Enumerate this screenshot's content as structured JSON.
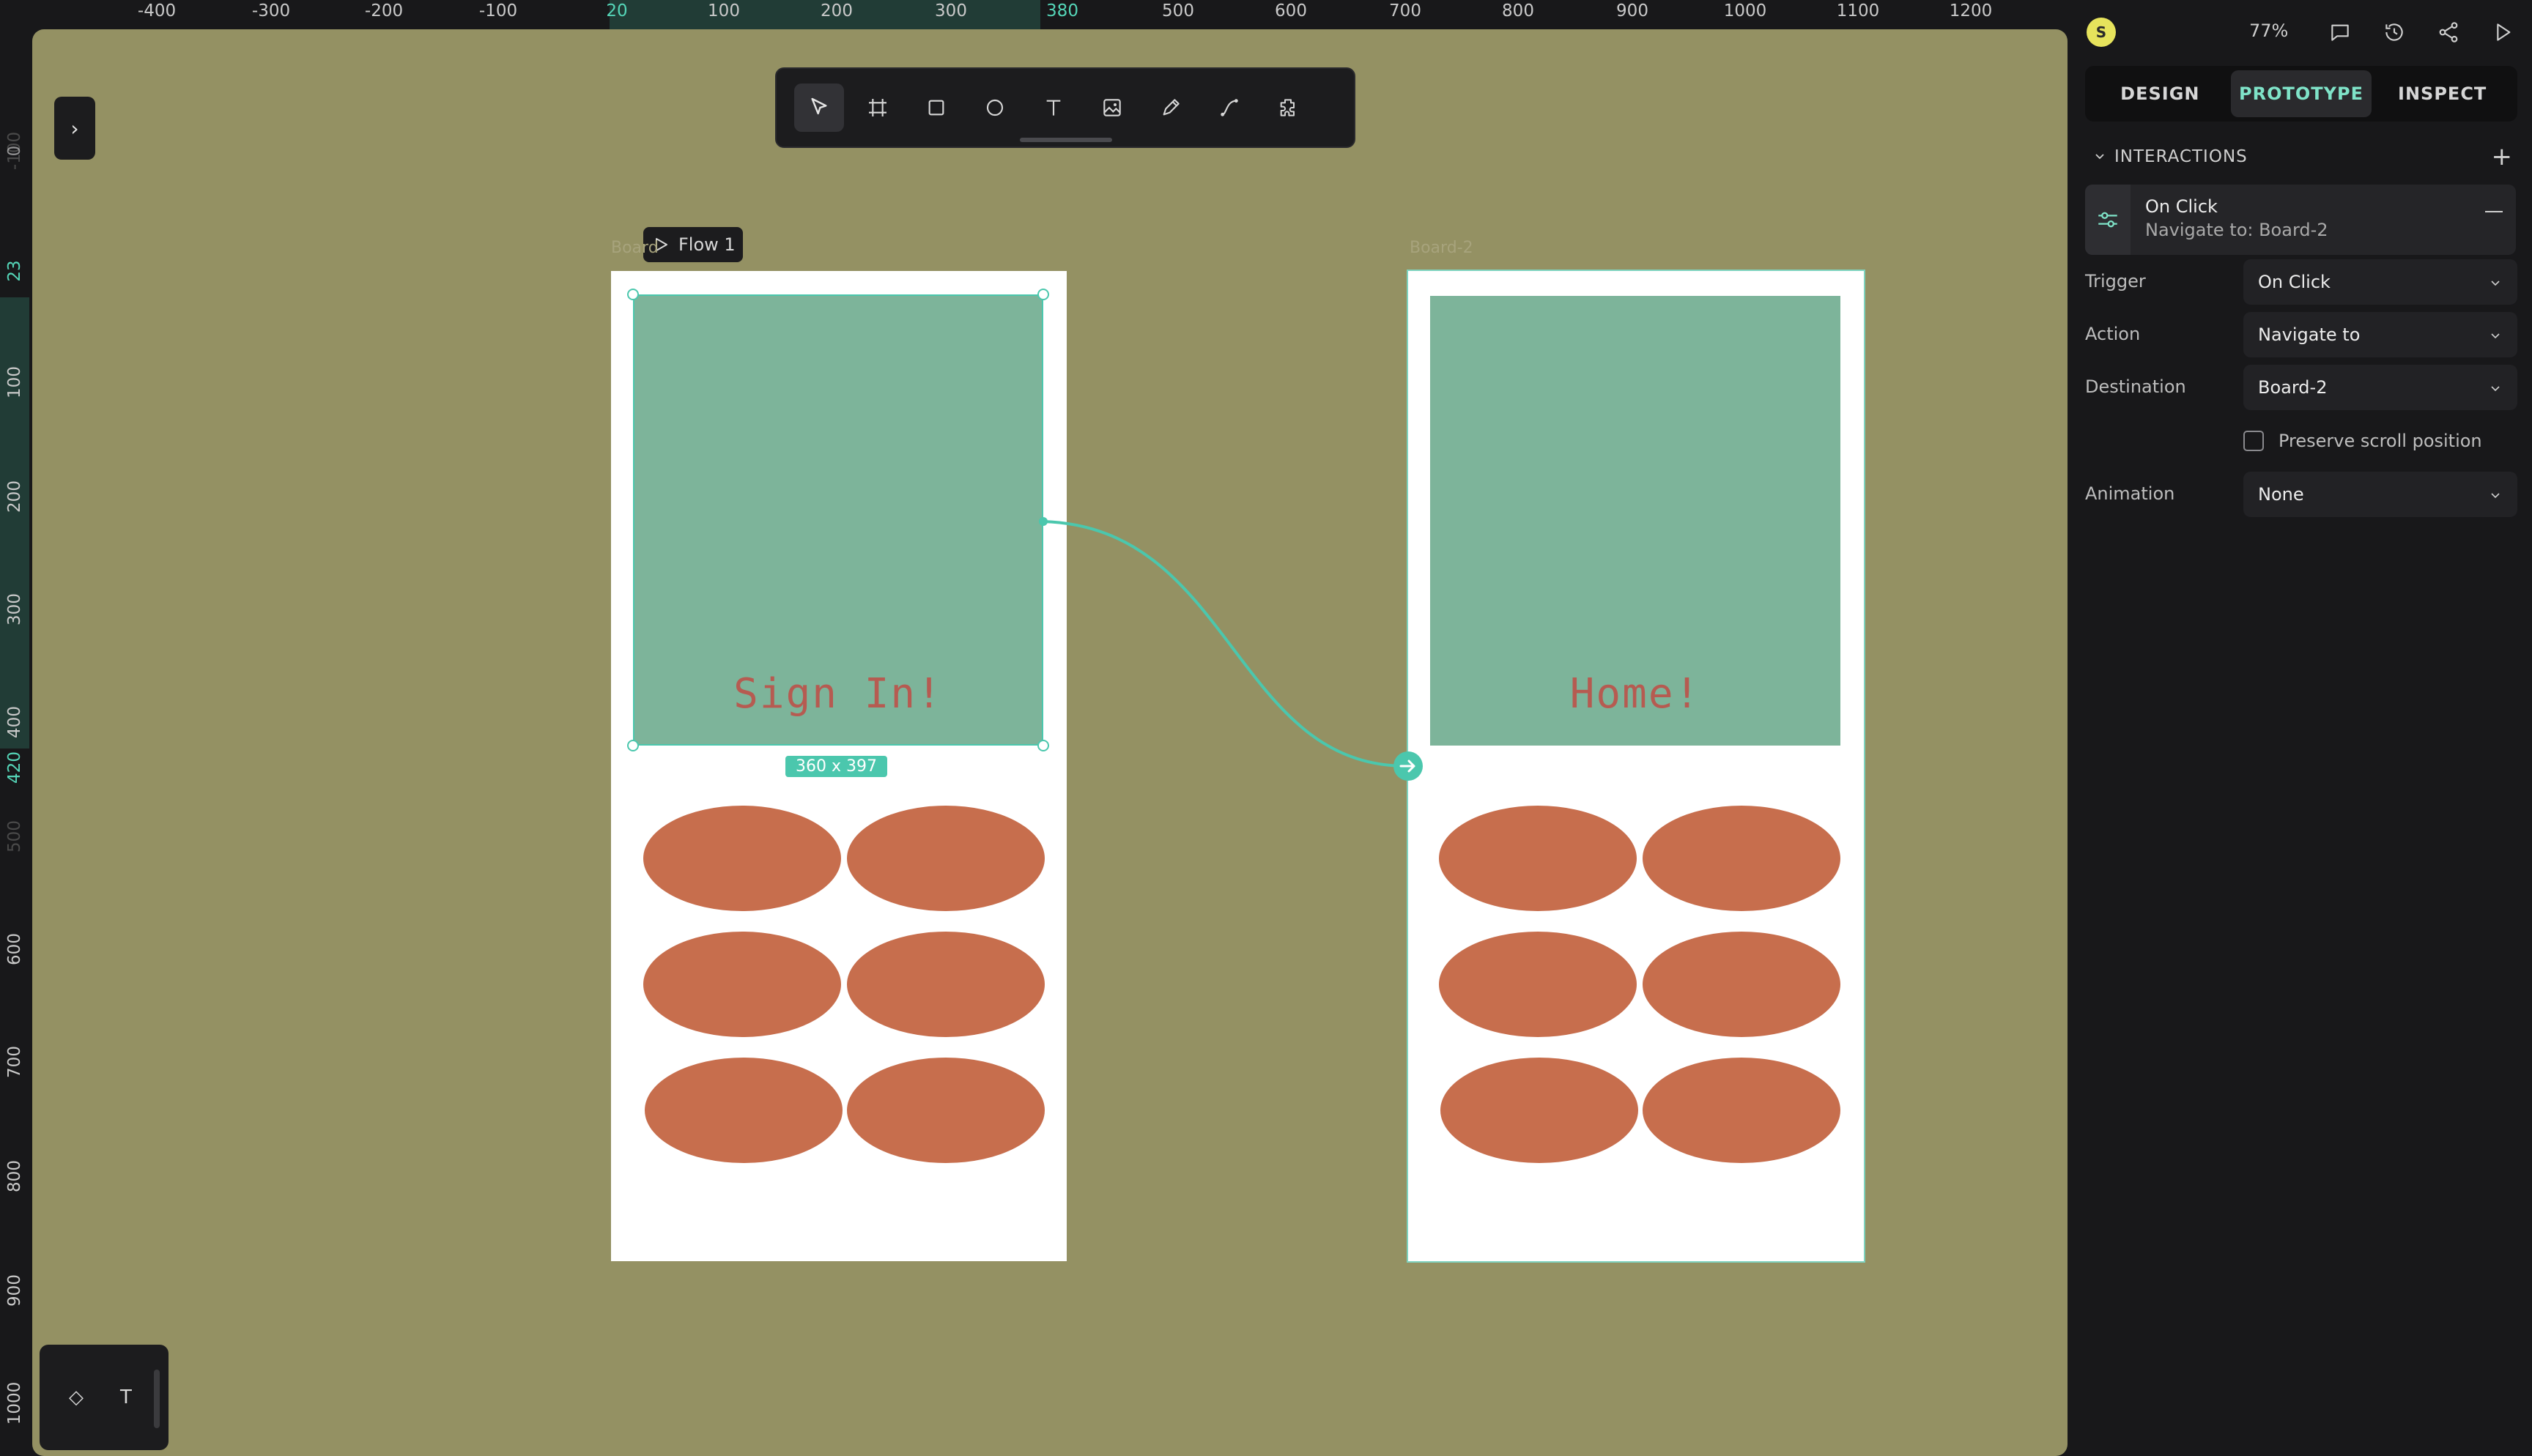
{
  "ruler": {
    "top_ticks": [
      "-400",
      "-300",
      "-200",
      "-100",
      "20",
      "100",
      "200",
      "300",
      "380",
      "500",
      "600",
      "700",
      "800",
      "900",
      "1000",
      "1100",
      "1200"
    ],
    "left_ticks": [
      "-100",
      "0",
      "23",
      "100",
      "200",
      "300",
      "400",
      "420",
      "500",
      "600",
      "700",
      "800",
      "900",
      "1000"
    ]
  },
  "toolbar": {
    "tools": [
      "pointer-icon",
      "board-icon",
      "rectangle-icon",
      "ellipse-icon",
      "text-icon",
      "image-icon",
      "pencil-icon",
      "path-icon",
      "plugin-icon"
    ]
  },
  "canvas": {
    "flow_label": "Flow 1",
    "boards": [
      {
        "label": "Board",
        "hero_text": "Sign In!"
      },
      {
        "label": "Board-2",
        "hero_text": "Home!"
      }
    ],
    "selection_size": "360 x 397",
    "colors": {
      "canvas_bg": "#949163",
      "hero": "#7db49a",
      "hero_text": "#b65b51",
      "ellipse": "#c76e4d",
      "accent": "#4bc7ad"
    }
  },
  "mini_tools": {
    "items": [
      "◇",
      "T"
    ]
  },
  "panel": {
    "avatar_initial": "S",
    "zoom": "77%",
    "tabs": [
      "DESIGN",
      "PROTOTYPE",
      "INSPECT"
    ],
    "active_tab": "PROTOTYPE",
    "section_title": "INTERACTIONS",
    "interaction": {
      "title": "On Click",
      "subtitle": "Navigate to: Board-2"
    },
    "fields": {
      "trigger": {
        "label": "Trigger",
        "value": "On Click"
      },
      "action": {
        "label": "Action",
        "value": "Navigate to"
      },
      "destination": {
        "label": "Destination",
        "value": "Board-2"
      },
      "animation": {
        "label": "Animation",
        "value": "None"
      }
    },
    "preserve_scroll": {
      "label": "Preserve scroll position",
      "checked": false
    }
  }
}
